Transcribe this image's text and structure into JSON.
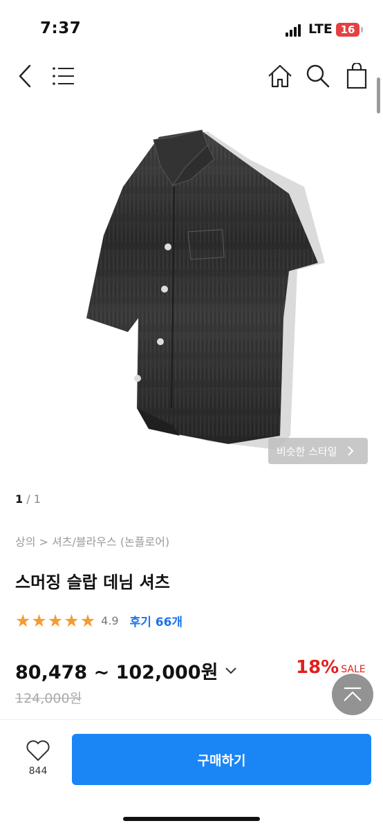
{
  "status_bar": {
    "time": "7:37",
    "network": "LTE",
    "battery": "16"
  },
  "header": {
    "icons": [
      "back-icon",
      "menu-icon",
      "home-icon",
      "search-icon",
      "cart-icon"
    ]
  },
  "product": {
    "similar_style_label": "비슷한 스타일",
    "page_current": "1",
    "page_total": "/ 1",
    "breadcrumb": "상의 > 셔츠/블라우스 (논플로어)",
    "title": "스머징 슬랍 데님 셔츠",
    "rating": 4.9,
    "rating_text": "4.9",
    "review_label": "후기 66개",
    "price_range": "80,478 ~ 102,000원",
    "discount_percent": "18%",
    "sale_label": "SALE",
    "original_price": "124,000원"
  },
  "bottom_bar": {
    "like_count": "844",
    "buy_label": "구매하기"
  },
  "colors": {
    "accent_blue": "#1a86f5",
    "link_blue": "#1a73e8",
    "star_orange": "#f59b33",
    "sale_red": "#e02020"
  }
}
